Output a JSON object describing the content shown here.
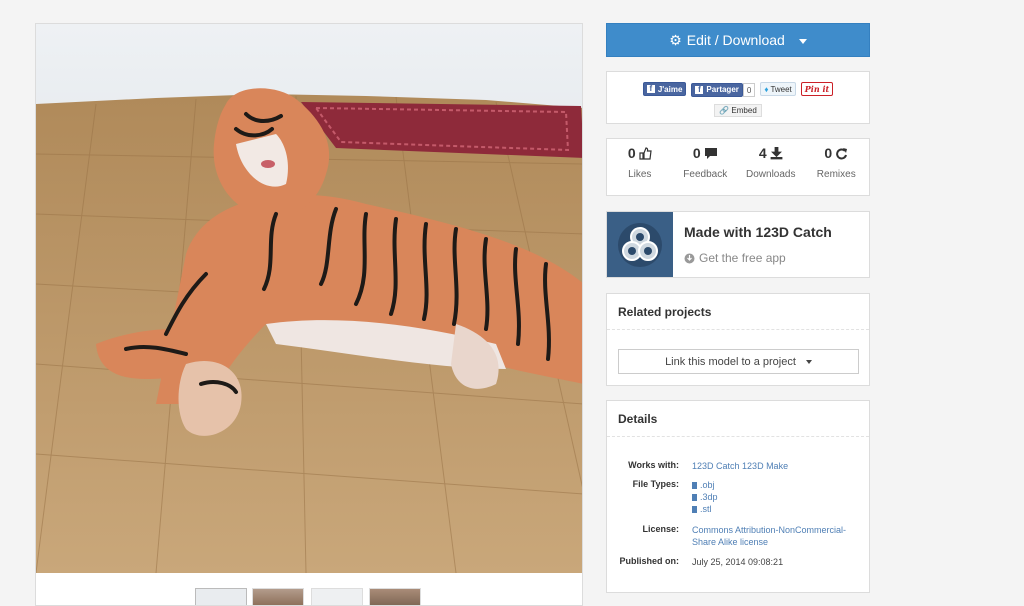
{
  "edit_button": {
    "label": "Edit / Download",
    "icon": "gear-icon"
  },
  "share": {
    "facebook_like": "J'aime",
    "facebook_share": "Partager",
    "share_count": "0",
    "tweet": "Tweet",
    "pinterest": "Pin it",
    "embed": "Embed"
  },
  "stats": [
    {
      "value": "0",
      "label": "Likes",
      "icon": "thumbs-up-icon"
    },
    {
      "value": "0",
      "label": "Feedback",
      "icon": "comment-icon"
    },
    {
      "value": "4",
      "label": "Downloads",
      "icon": "download-icon"
    },
    {
      "value": "0",
      "label": "Remixes",
      "icon": "remix-icon"
    }
  ],
  "catch": {
    "title": "Made with 123D Catch",
    "subtitle": "Get the free app"
  },
  "related": {
    "title": "Related projects",
    "link_button": "Link this model to a project"
  },
  "details": {
    "title": "Details",
    "works_with_label": "Works with:",
    "works_with": [
      "123D Catch",
      "123D Make"
    ],
    "file_types_label": "File Types:",
    "file_types": [
      ".obj",
      ".3dp",
      ".stl"
    ],
    "license_label": "License:",
    "license_line1": "Commons Attribution-NonCommercial-",
    "license_line2": "Share Alike license",
    "published_label": "Published on:",
    "published": "July 25, 2014 09:08:21"
  },
  "colors": {
    "accent": "#3f8ccb",
    "link": "#4f7fb5"
  }
}
